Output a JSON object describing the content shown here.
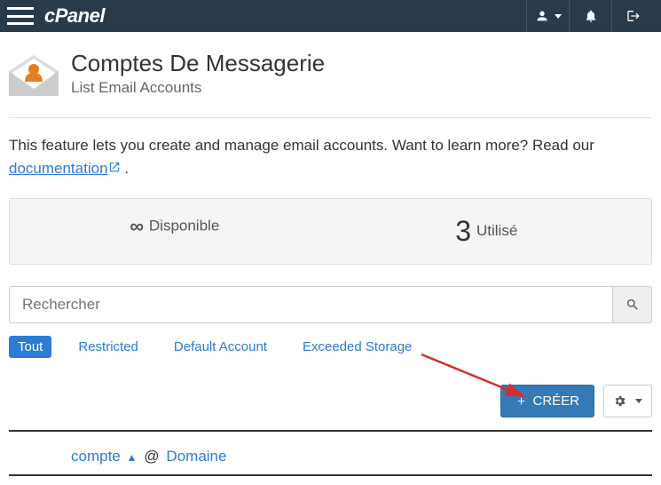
{
  "header": {
    "logo_text": "cPanel"
  },
  "page": {
    "title": "Comptes De Messagerie",
    "subtitle": "List Email Accounts",
    "intro_text": "This feature lets you create and manage email accounts. Want to learn more? Read our ",
    "doc_link_text": "documentation",
    "intro_end": " ."
  },
  "stats": {
    "available_label": "Disponible",
    "available_symbol": "∞",
    "used_value": "3",
    "used_label": "Utilisé"
  },
  "search": {
    "placeholder": "Rechercher"
  },
  "filters": {
    "all": "Tout",
    "restricted": "Restricted",
    "default_account": "Default Account",
    "exceeded": "Exceeded Storage"
  },
  "actions": {
    "create_label": "CRÉER"
  },
  "table": {
    "col_account": "compte",
    "col_domain": "Domaine"
  }
}
